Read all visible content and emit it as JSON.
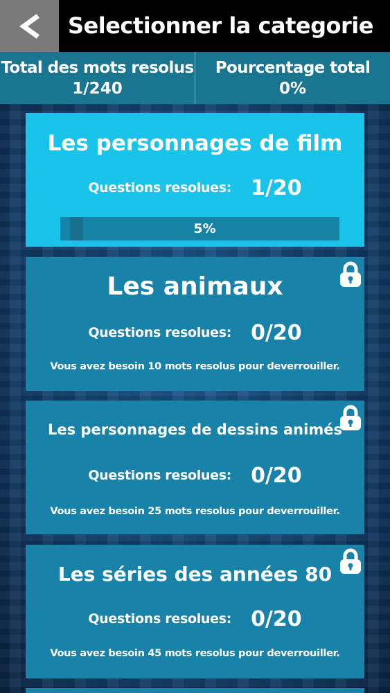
{
  "header": {
    "back_label": "<",
    "title": "Selectionner la categorie"
  },
  "stats": {
    "total_label": "Total des mots resolus",
    "total_value": "1/240",
    "percent_label": "Pourcentage total",
    "percent_value": "0%"
  },
  "colors": {
    "active_card": "#19c3ea",
    "locked_card": "#1982a8",
    "top_bar": "#000000",
    "back_button": "#7a7a7a",
    "stats_bar": "#1a7590"
  },
  "categories": [
    {
      "title": "Les personnages de film",
      "questions_label": "Questions resolues:",
      "count": "1/20",
      "progress_text": "5%",
      "progress_fraction": 0.05,
      "locked": false
    },
    {
      "title": "Les animaux",
      "questions_label": "Questions resolues:",
      "count": "0/20",
      "unlock_note": "Vous avez besoin 10 mots resolus pour deverrouiller.",
      "locked": true,
      "icon": "lock-icon"
    },
    {
      "title": "Les personnages de dessins animés",
      "questions_label": "Questions resolues:",
      "count": "0/20",
      "unlock_note": "Vous avez besoin 25 mots resolus pour deverrouiller.",
      "locked": true,
      "icon": "lock-icon"
    },
    {
      "title": "Les séries des années 80",
      "questions_label": "Questions resolues:",
      "count": "0/20",
      "unlock_note": "Vous avez besoin 45 mots resolus pour deverrouiller.",
      "locked": true,
      "icon": "lock-icon"
    }
  ]
}
